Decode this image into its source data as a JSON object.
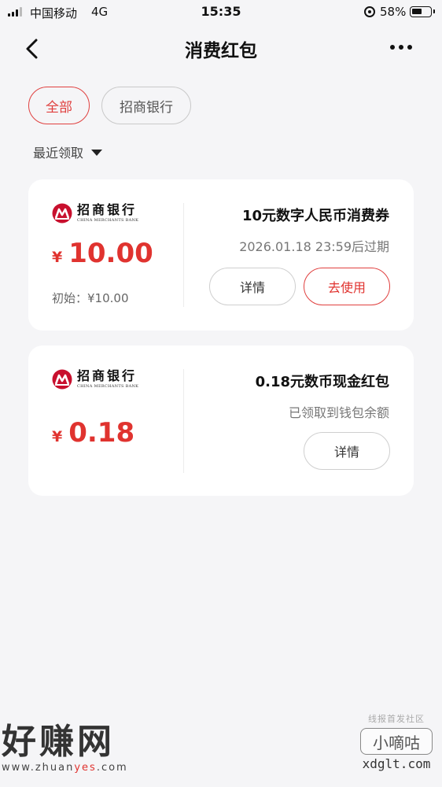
{
  "status_bar": {
    "carrier": "中国移动",
    "network": "4G",
    "time": "15:35",
    "battery_percent": "58%",
    "battery_level": 0.58
  },
  "nav": {
    "title": "消费红包",
    "back_icon": "chevron-left-icon",
    "more_icon": "more-dots-icon"
  },
  "filters": [
    {
      "label": "全部",
      "active": true
    },
    {
      "label": "招商银行",
      "active": false
    }
  ],
  "sort": {
    "label": "最近领取",
    "icon": "caret-down-icon"
  },
  "coupons": [
    {
      "bank_name_cn": "招商银行",
      "bank_name_en": "CHINA MERCHANTS BANK",
      "currency": "¥",
      "amount": "10.00",
      "initial": "初始：¥10.00",
      "title": "10元数字人民币消费券",
      "subtitle": "2026.01.18 23:59后过期",
      "detail_label": "详情",
      "use_label": "去使用"
    },
    {
      "bank_name_cn": "招商银行",
      "bank_name_en": "CHINA MERCHANTS BANK",
      "currency": "¥",
      "amount": "0.18",
      "title": "0.18元数币现金红包",
      "subtitle": "已领取到钱包余额",
      "detail_label": "详情"
    }
  ],
  "watermark": {
    "left_main": "好赚网",
    "left_sub_a": "www.zhuan",
    "left_sub_b": "yes",
    "left_sub_c": ".com",
    "right_top": "线报首发社区",
    "right_box": "小嘀咕",
    "right_bottom": "xdglt.com"
  },
  "colors": {
    "accent": "#e0332f",
    "background": "#f5f5f7",
    "card": "#ffffff"
  }
}
